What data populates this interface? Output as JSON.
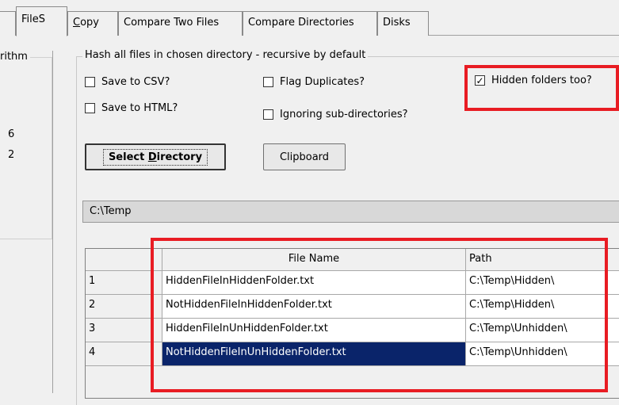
{
  "tabs": [
    {
      "label": "FileS",
      "active": true
    },
    {
      "label": "Copy",
      "accel": "C",
      "rest": "opy"
    },
    {
      "label": "Compare Two Files"
    },
    {
      "label": "Compare Directories"
    },
    {
      "label": "Disks"
    }
  ],
  "left_panel": {
    "legend_fragment": "rithm",
    "line1": "6",
    "line2": "2"
  },
  "group": {
    "legend": "Hash all files in chosen directory - recursive by default"
  },
  "options": {
    "save_csv": {
      "label": "Save to CSV?",
      "checked": false
    },
    "save_html": {
      "label": "Save to HTML?",
      "checked": false
    },
    "flag_duplicates": {
      "label": "Flag Duplicates?",
      "checked": false
    },
    "ignoring_subdirs": {
      "label": "Ignoring sub-directories?",
      "checked": false
    },
    "hidden_folders": {
      "label": "Hidden folders too?",
      "checked": true
    }
  },
  "buttons": {
    "select_directory": {
      "label": "Select Directory",
      "pre": "Select ",
      "accel": "D",
      "post": "irectory"
    },
    "clipboard": "Clipboard"
  },
  "path_field": {
    "value": "C:\\Temp"
  },
  "grid": {
    "columns": [
      "",
      "File Name",
      "Path"
    ],
    "rows": [
      {
        "num": "1",
        "file": "HiddenFileInHiddenFolder.txt",
        "path": "C:\\Temp\\Hidden\\",
        "selected": false
      },
      {
        "num": "2",
        "file": "NotHiddenFileInHiddenFolder.txt",
        "path": "C:\\Temp\\Hidden\\",
        "selected": false
      },
      {
        "num": "3",
        "file": "HiddenFileInUnHiddenFolder.txt",
        "path": "C:\\Temp\\Unhidden\\",
        "selected": false
      },
      {
        "num": "4",
        "file": "NotHiddenFileInUnHiddenFolder.txt",
        "path": "C:\\Temp\\Unhidden\\",
        "selected": true
      }
    ]
  },
  "colors": {
    "highlight": "#e81c23",
    "selection": "#0a246a"
  },
  "icons": {
    "check": "check-icon"
  }
}
